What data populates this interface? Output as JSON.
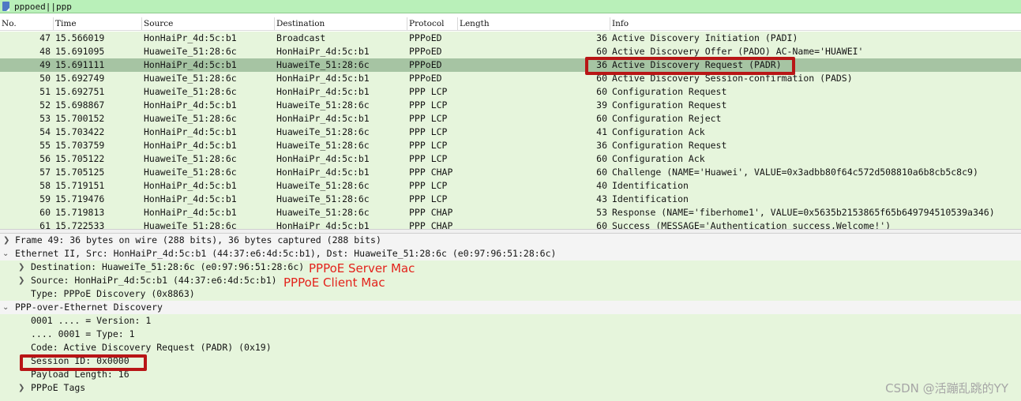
{
  "filter": {
    "value": "pppoed||ppp"
  },
  "columns": {
    "no": "No.",
    "time": "Time",
    "source": "Source",
    "destination": "Destination",
    "protocol": "Protocol",
    "length": "Length",
    "info": "Info"
  },
  "packets": [
    {
      "no": "47",
      "time": "15.566019",
      "src": "HonHaiPr_4d:5c:b1",
      "dst": "Broadcast",
      "proto": "PPPoED",
      "len": "36",
      "info": "Active Discovery Initiation (PADI)"
    },
    {
      "no": "48",
      "time": "15.691095",
      "src": "HuaweiTe_51:28:6c",
      "dst": "HonHaiPr_4d:5c:b1",
      "proto": "PPPoED",
      "len": "60",
      "info": "Active Discovery Offer (PADO) AC-Name='HUAWEI'"
    },
    {
      "no": "49",
      "time": "15.691111",
      "src": "HonHaiPr_4d:5c:b1",
      "dst": "HuaweiTe_51:28:6c",
      "proto": "PPPoED",
      "len": "36",
      "info": "Active Discovery Request (PADR)"
    },
    {
      "no": "50",
      "time": "15.692749",
      "src": "HuaweiTe_51:28:6c",
      "dst": "HonHaiPr_4d:5c:b1",
      "proto": "PPPoED",
      "len": "60",
      "info": "Active Discovery Session-confirmation (PADS)"
    },
    {
      "no": "51",
      "time": "15.692751",
      "src": "HuaweiTe_51:28:6c",
      "dst": "HonHaiPr_4d:5c:b1",
      "proto": "PPP LCP",
      "len": "60",
      "info": "Configuration Request"
    },
    {
      "no": "52",
      "time": "15.698867",
      "src": "HonHaiPr_4d:5c:b1",
      "dst": "HuaweiTe_51:28:6c",
      "proto": "PPP LCP",
      "len": "39",
      "info": "Configuration Request"
    },
    {
      "no": "53",
      "time": "15.700152",
      "src": "HuaweiTe_51:28:6c",
      "dst": "HonHaiPr_4d:5c:b1",
      "proto": "PPP LCP",
      "len": "60",
      "info": "Configuration Reject"
    },
    {
      "no": "54",
      "time": "15.703422",
      "src": "HonHaiPr_4d:5c:b1",
      "dst": "HuaweiTe_51:28:6c",
      "proto": "PPP LCP",
      "len": "41",
      "info": "Configuration Ack"
    },
    {
      "no": "55",
      "time": "15.703759",
      "src": "HonHaiPr_4d:5c:b1",
      "dst": "HuaweiTe_51:28:6c",
      "proto": "PPP LCP",
      "len": "36",
      "info": "Configuration Request"
    },
    {
      "no": "56",
      "time": "15.705122",
      "src": "HuaweiTe_51:28:6c",
      "dst": "HonHaiPr_4d:5c:b1",
      "proto": "PPP LCP",
      "len": "60",
      "info": "Configuration Ack"
    },
    {
      "no": "57",
      "time": "15.705125",
      "src": "HuaweiTe_51:28:6c",
      "dst": "HonHaiPr_4d:5c:b1",
      "proto": "PPP CHAP",
      "len": "60",
      "info": "Challenge (NAME='Huawei', VALUE=0x3adbb80f64c572d508810a6b8cb5c8c9)"
    },
    {
      "no": "58",
      "time": "15.719151",
      "src": "HonHaiPr_4d:5c:b1",
      "dst": "HuaweiTe_51:28:6c",
      "proto": "PPP LCP",
      "len": "40",
      "info": "Identification"
    },
    {
      "no": "59",
      "time": "15.719476",
      "src": "HonHaiPr_4d:5c:b1",
      "dst": "HuaweiTe_51:28:6c",
      "proto": "PPP LCP",
      "len": "43",
      "info": "Identification"
    },
    {
      "no": "60",
      "time": "15.719813",
      "src": "HonHaiPr_4d:5c:b1",
      "dst": "HuaweiTe_51:28:6c",
      "proto": "PPP CHAP",
      "len": "53",
      "info": "Response (NAME='fiberhome1', VALUE=0x5635b2153865f65b649794510539a346)"
    },
    {
      "no": "61",
      "time": "15.722533",
      "src": "HuaweiTe_51:28:6c",
      "dst": "HonHaiPr_4d:5c:b1",
      "proto": "PPP CHAP",
      "len": "60",
      "info": "Success (MESSAGE='Authentication success,Welcome!')"
    }
  ],
  "selected_packet": "49",
  "details": {
    "frame": "Frame 49: 36 bytes on wire (288 bits), 36 bytes captured (288 bits)",
    "ethernet": "Ethernet II, Src: HonHaiPr_4d:5c:b1 (44:37:e6:4d:5c:b1), Dst: HuaweiTe_51:28:6c (e0:97:96:51:28:6c)",
    "eth_destination": "Destination: HuaweiTe_51:28:6c (e0:97:96:51:28:6c)",
    "eth_source": "Source: HonHaiPr_4d:5c:b1 (44:37:e6:4d:5c:b1)",
    "eth_type": "Type: PPPoE Discovery (0x8863)",
    "pppoe": "PPP-over-Ethernet Discovery",
    "version": "0001 .... = Version: 1",
    "type": ".... 0001 = Type: 1",
    "code": "Code: Active Discovery Request (PADR) (0x19)",
    "session_id": "Session ID: 0x0000",
    "payload_length": "Payload Length: 16",
    "tags": "PPPoE Tags"
  },
  "annotations": {
    "server_mac": "PPPoE Server Mac",
    "client_mac": "PPPoE Client Mac"
  },
  "icons": {
    "expand": "chevron-right-icon",
    "collapse": "chevron-down-icon",
    "filter": "bookmark-icon"
  },
  "colors": {
    "row_bg": "#e6f5dc",
    "selected_bg": "#a6c4a3",
    "highlight": "#b81616",
    "annotation": "#e3231c",
    "filter_bg": "#b9f0b9"
  },
  "watermark": "CSDN @活蹦乱跳的YY"
}
